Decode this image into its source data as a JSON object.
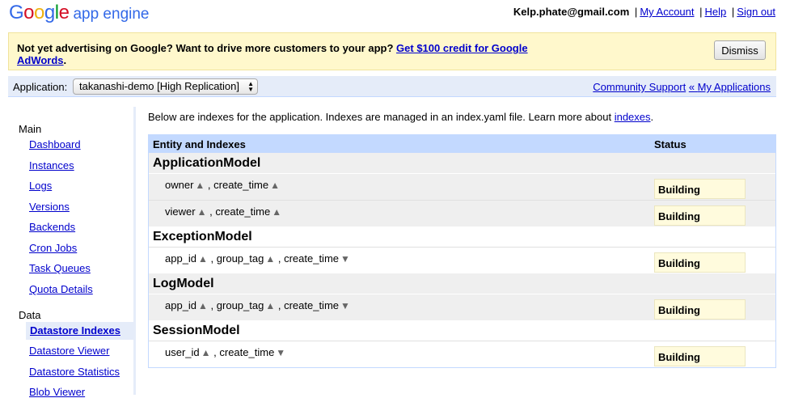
{
  "header": {
    "logo_google": [
      "G",
      "o",
      "o",
      "g",
      "l",
      "e"
    ],
    "logo_product": "app engine",
    "email": "Kelp.phate@gmail.com",
    "links": [
      "My Account",
      "Help",
      "Sign out"
    ]
  },
  "promo": {
    "text": "Not yet advertising on Google? Want to drive more customers to your app?",
    "link": "Get $100 credit for Google AdWords",
    "after": ".",
    "dismiss_label": "Dismiss"
  },
  "appbar": {
    "label": "Application:",
    "selected_app": "takanashi-demo [High Replication]",
    "community_support": "Community Support",
    "my_applications": "My Applications",
    "arrows": "«"
  },
  "sidebar": {
    "main_heading": "Main",
    "main_items": [
      "Dashboard",
      "Instances",
      "Logs",
      "Versions",
      "Backends",
      "Cron Jobs",
      "Task Queues",
      "Quota Details"
    ],
    "data_heading": "Data",
    "data_items": [
      "Datastore Indexes",
      "Datastore Viewer",
      "Datastore Statistics",
      "Blob Viewer"
    ],
    "selected": "Datastore Indexes"
  },
  "content": {
    "intro": "Below are indexes for the application. Indexes are managed in an index.yaml file. Learn more about",
    "intro_link": "indexes",
    "intro_after": ".",
    "col_entity": "Entity and Indexes",
    "col_status": "Status",
    "entities": [
      {
        "name": "ApplicationModel",
        "indexes": [
          {
            "props": [
              {
                "name": "owner",
                "dir": "asc"
              },
              {
                "name": "create_time",
                "dir": "asc"
              }
            ],
            "status": "Building"
          },
          {
            "props": [
              {
                "name": "viewer",
                "dir": "asc"
              },
              {
                "name": "create_time",
                "dir": "asc"
              }
            ],
            "status": "Building"
          }
        ]
      },
      {
        "name": "ExceptionModel",
        "indexes": [
          {
            "props": [
              {
                "name": "app_id",
                "dir": "asc"
              },
              {
                "name": "group_tag",
                "dir": "asc"
              },
              {
                "name": "create_time",
                "dir": "desc"
              }
            ],
            "status": "Building"
          }
        ]
      },
      {
        "name": "LogModel",
        "indexes": [
          {
            "props": [
              {
                "name": "app_id",
                "dir": "asc"
              },
              {
                "name": "group_tag",
                "dir": "asc"
              },
              {
                "name": "create_time",
                "dir": "desc"
              }
            ],
            "status": "Building"
          }
        ]
      },
      {
        "name": "SessionModel",
        "indexes": [
          {
            "props": [
              {
                "name": "user_id",
                "dir": "asc"
              },
              {
                "name": "create_time",
                "dir": "desc"
              }
            ],
            "status": "Building"
          }
        ]
      }
    ]
  },
  "colors": {
    "link": "#0000cc",
    "nav_highlight": "#e5ecf9",
    "table_header": "#c3d9ff",
    "promo_bg": "#fff8cc",
    "status_bg": "#fffbdd"
  }
}
